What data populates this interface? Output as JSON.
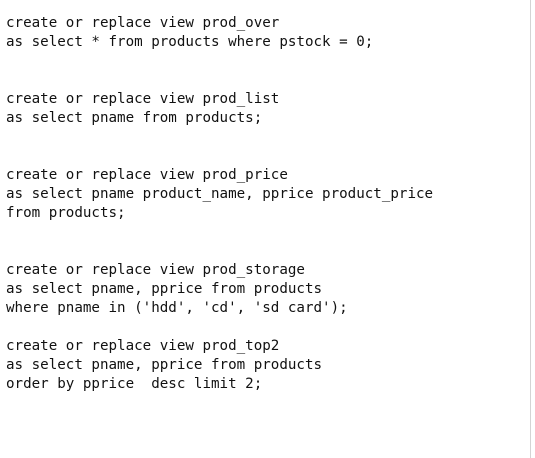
{
  "editor": {
    "lines": [
      "create or replace view prod_over",
      "as select * from products where pstock = 0;",
      "create or replace view prod_list",
      "as select pname from products;",
      "create or replace view prod_price",
      "as select pname product_name, pprice product_price",
      "from products;",
      "create or replace view prod_storage",
      "as select pname, pprice from products",
      "where pname in ('hdd', 'cd', 'sd card');",
      "create or replace view prod_top2",
      "as select pname, pprice from products",
      "order by pprice  desc limit 2;"
    ]
  }
}
